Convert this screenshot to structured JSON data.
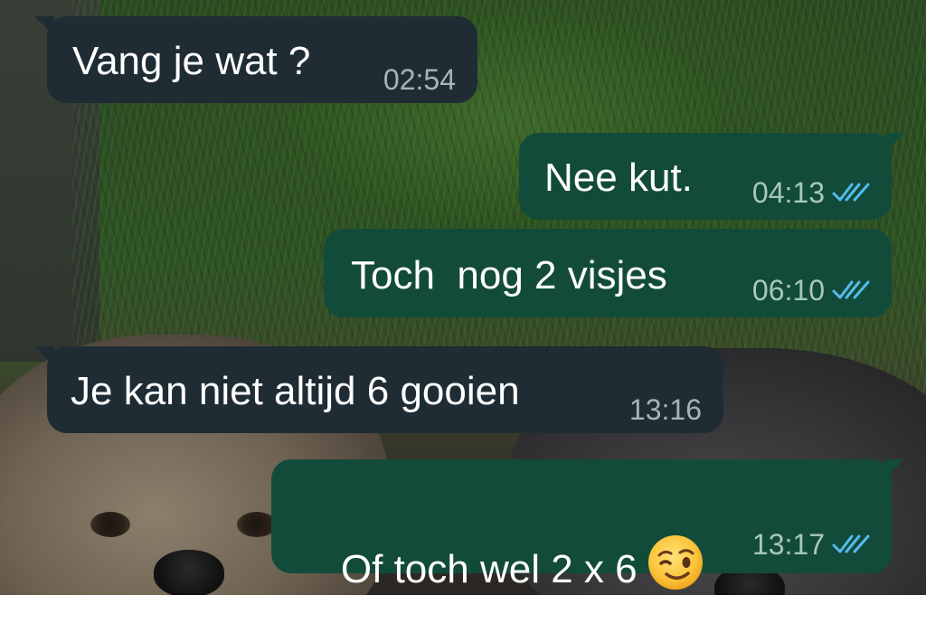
{
  "chat": {
    "messages": [
      {
        "direction": "incoming",
        "text": "Vang je wat ?",
        "time": "02:54"
      },
      {
        "direction": "outgoing",
        "text": "Nee kut.",
        "time": "04:13",
        "status": "read"
      },
      {
        "direction": "outgoing",
        "text": "Toch  nog 2 visjes",
        "time": "06:10",
        "status": "read"
      },
      {
        "direction": "incoming",
        "text": "Je kan niet altijd 6 gooien",
        "time": "13:16"
      },
      {
        "direction": "outgoing",
        "text": "Of toch wel 2 x 6",
        "emoji": "winking-face",
        "time": "13:17",
        "status": "read"
      }
    ]
  },
  "colors": {
    "incoming_bubble": "#1f2c34",
    "outgoing_bubble": "#124b3a",
    "read_ticks": "#53bdeb"
  },
  "icons": {
    "read_receipt": "double-check-icon",
    "emoji": "winking-face-emoji-icon"
  },
  "wallpaper": "photo of grass with two dogs"
}
